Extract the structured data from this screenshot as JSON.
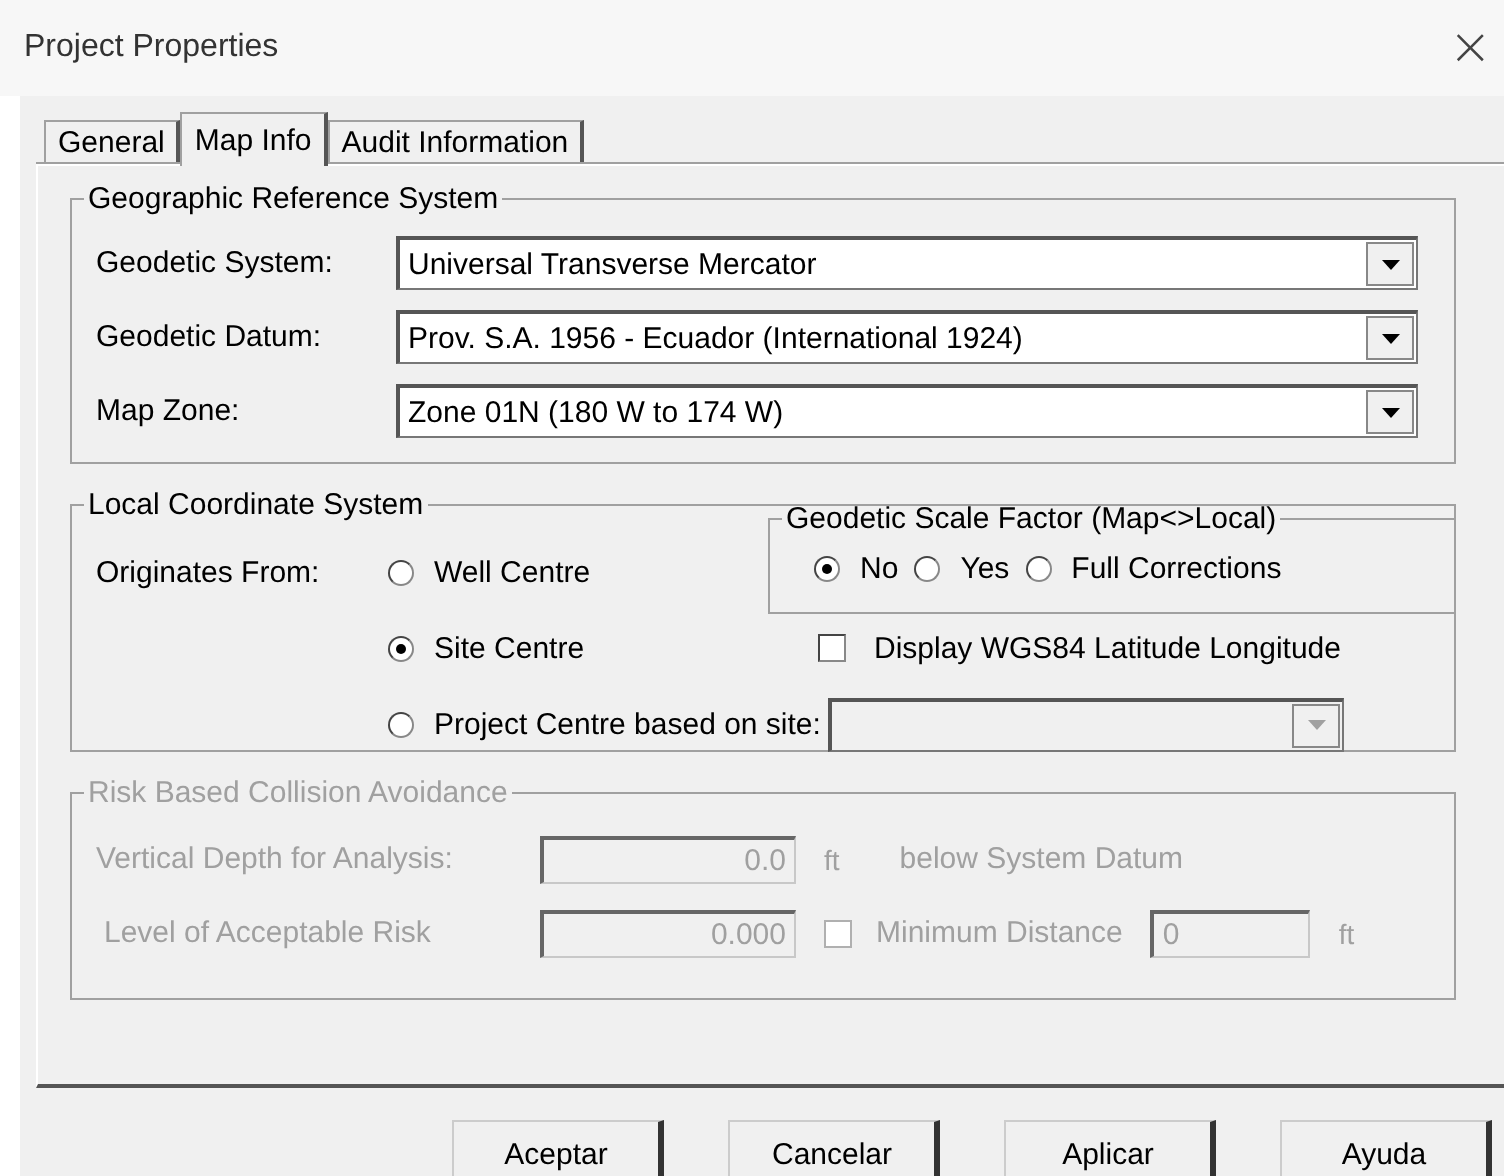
{
  "window": {
    "title": "Project Properties",
    "close": "×"
  },
  "tabs": [
    {
      "label": "General",
      "selected": false
    },
    {
      "label": "Map Info",
      "selected": true
    },
    {
      "label": "Audit Information",
      "selected": false
    }
  ],
  "geographic_reference": {
    "title": "Geographic Reference System",
    "fields": [
      {
        "label": "Geodetic System:",
        "value": "Universal Transverse Mercator"
      },
      {
        "label": "Geodetic Datum:",
        "value": "Prov. S.A. 1956 - Ecuador (International 1924)"
      },
      {
        "label": "Map Zone:",
        "value": "Zone 01N (180 W to 174 W)"
      }
    ]
  },
  "local_coordinate_system": {
    "title": "Local Coordinate System",
    "originates_label": "Originates From:",
    "options": [
      {
        "label": "Well Centre",
        "selected": false
      },
      {
        "label": "Site Centre",
        "selected": true
      },
      {
        "label": "Project Centre based on site:",
        "selected": false
      }
    ],
    "site_combo": {
      "disabled": true
    }
  },
  "geodetic_scale_factor": {
    "title": "Geodetic Scale Factor (Map<>Local)",
    "options": [
      {
        "label": "No",
        "selected": true
      },
      {
        "label": "Yes",
        "selected": false
      },
      {
        "label": "Full Corrections",
        "selected": false
      }
    ]
  },
  "display_wgs84": {
    "label": "Display WGS84 Latitude Longitude",
    "checked": false
  },
  "risk_collision": {
    "title": "Risk Based Collision Avoidance",
    "disabled": true,
    "vertical_depth": {
      "label": "Vertical Depth for Analysis:",
      "value": "0.0",
      "unit": "ft",
      "note": "below System Datum"
    },
    "acceptable_risk": {
      "label": "Level of Acceptable Risk",
      "value": "0.000"
    },
    "minimum_distance": {
      "label": "Minimum Distance",
      "checked": false,
      "value": "0",
      "unit": "ft"
    }
  },
  "buttons": [
    "Aceptar",
    "Cancelar",
    "Aplicar",
    "Ayuda"
  ]
}
